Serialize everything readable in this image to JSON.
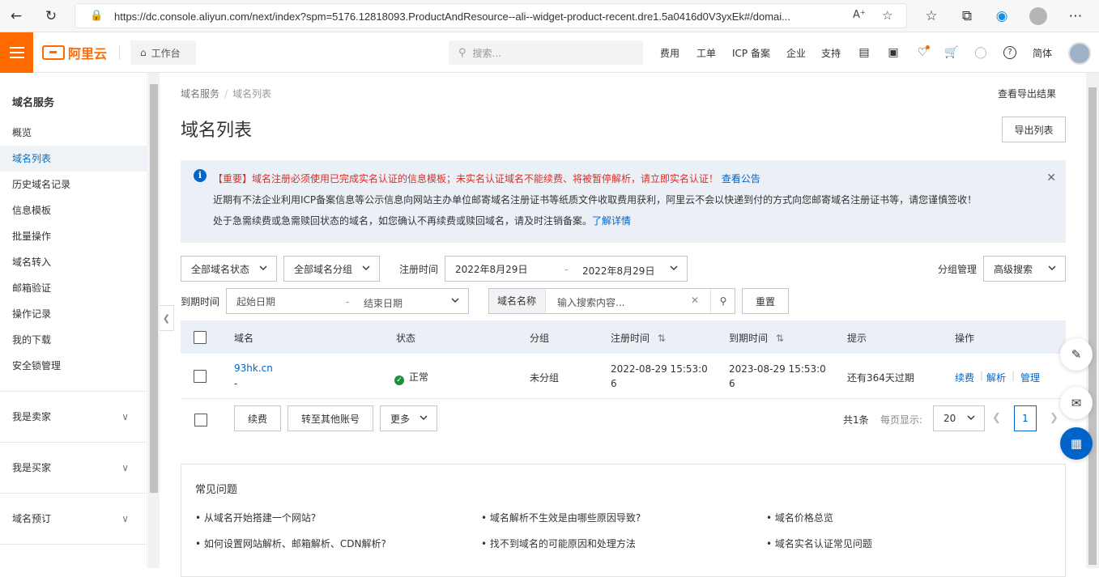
{
  "browser": {
    "url": "https://dc.console.aliyun.com/next/index?spm=5176.12818093.ProductAndResource--ali--widget-product-recent.dre1.5a0416d0V3yxEk#/domai..."
  },
  "topnav": {
    "logo_text": "阿里云",
    "workbench": "工作台",
    "search_placeholder": "搜索...",
    "links": [
      "费用",
      "工单",
      "ICP 备案",
      "企业",
      "支持"
    ],
    "lang": "简体"
  },
  "sidebar": {
    "title": "域名服务",
    "items": [
      "概览",
      "域名列表",
      "历史域名记录",
      "信息模板",
      "批量操作",
      "域名转入",
      "邮箱验证",
      "操作记录",
      "我的下载",
      "安全锁管理"
    ],
    "active_index": 1,
    "groups": [
      "我是卖家",
      "我是买家",
      "域名预订"
    ]
  },
  "breadcrumb": {
    "root": "域名服务",
    "current": "域名列表"
  },
  "page": {
    "title": "域名列表",
    "export_result": "查看导出结果",
    "export_button": "导出列表"
  },
  "notice": {
    "line1": "【重要】域名注册必须使用已完成实名认证的信息模板；未实名认证域名不能续费、将被暂停解析，请立即实名认证！",
    "line1_link": "查看公告",
    "line2": "近期有不法企业利用ICP备案信息等公示信息向网站主办单位邮寄域名注册证书等纸质文件收取费用获利，阿里云不会以快递到付的方式向您邮寄域名注册证书等，请您谨慎签收！",
    "line3": "处于急需续费或急需赎回状态的域名，如您确认不再续费或赎回域名，请及时注销备案。",
    "line3_link": "了解详情"
  },
  "filters": {
    "status": "全部域名状态",
    "group": "全部域名分组",
    "reg_time_label": "注册时间",
    "reg_start": "2022年8月29日",
    "reg_end": "2022年8月29日",
    "group_manage": "分组管理",
    "advanced": "高级搜索",
    "exp_time_label": "到期时间",
    "exp_start_placeholder": "起始日期",
    "exp_end_placeholder": "结束日期",
    "search_field": "域名名称",
    "search_placeholder": "输入搜索内容...",
    "reset": "重置",
    "dash": "-"
  },
  "table": {
    "headers": {
      "domain": "域名",
      "status": "状态",
      "group": "分组",
      "reg": "注册时间",
      "exp": "到期时间",
      "hint": "提示",
      "ops": "操作"
    },
    "rows": [
      {
        "domain": "93hk.cn",
        "sub": "-",
        "status": "正常",
        "group": "未分组",
        "reg_line1": "2022-08-29 15:53:0",
        "reg_line2": "6",
        "exp_line1": "2023-08-29 15:53:0",
        "exp_line2": "6",
        "hint": "还有364天过期",
        "ops": [
          "续费",
          "解析",
          "管理"
        ]
      }
    ]
  },
  "bulk": {
    "renew": "续费",
    "transfer": "转至其他账号",
    "more": "更多",
    "total": "共1条",
    "per_page_label": "每页显示:",
    "per_page": "20",
    "page": "1"
  },
  "faq": {
    "title": "常见问题",
    "items": [
      "• 从域名开始搭建一个网站?",
      "• 域名解析不生效是由哪些原因导致?",
      "• 域名价格总览",
      "• 如何设置网站解析、邮箱解析、CDN解析?",
      "• 找不到域名的可能原因和处理方法",
      "• 域名实名认证常见问题"
    ]
  },
  "colors": {
    "brand": "#ff6a00",
    "link": "#0064c8",
    "notice_bg": "#ebf0f7",
    "warning_text": "#d93026",
    "ok": "#1e8e3e"
  }
}
